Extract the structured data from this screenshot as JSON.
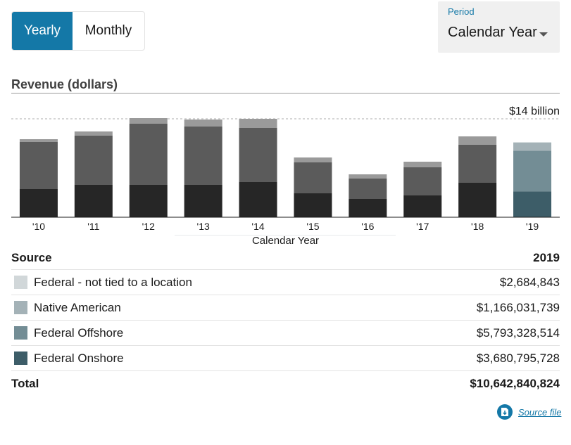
{
  "toggle": {
    "yearly": "Yearly",
    "monthly": "Monthly"
  },
  "period": {
    "label": "Period",
    "value": "Calendar Year"
  },
  "chart_data": {
    "type": "bar",
    "stacked": true,
    "title": "Revenue (dollars)",
    "xlabel": "Calendar Year",
    "max_label": "$14 billion",
    "ylim": [
      0,
      14000000000
    ],
    "categories": [
      "'10",
      "'11",
      "'12",
      "'13",
      "'14",
      "'15",
      "'16",
      "'17",
      "'18",
      "'19"
    ],
    "highlight_category": "'19",
    "series": [
      {
        "name": "Federal Onshore",
        "color": "#3d5d68",
        "values": [
          4000000000,
          4600000000,
          4600000000,
          4600000000,
          5000000000,
          3400000000,
          2600000000,
          3100000000,
          4900000000,
          3680795728
        ]
      },
      {
        "name": "Federal Offshore",
        "color": "#738d95",
        "values": [
          6700000000,
          7000000000,
          8700000000,
          8300000000,
          7700000000,
          4400000000,
          2900000000,
          4000000000,
          5400000000,
          5793328514
        ]
      },
      {
        "name": "Native American",
        "color": "#a4b2b7",
        "values": [
          400000000,
          600000000,
          800000000,
          1000000000,
          1300000000,
          700000000,
          600000000,
          800000000,
          1200000000,
          1166031739
        ]
      },
      {
        "name": "Federal - not tied to a location",
        "color": "#d1d7d9",
        "values": [
          0,
          0,
          0,
          0,
          0,
          0,
          0,
          0,
          0,
          2684843
        ]
      }
    ],
    "grayscale": [
      "#262626",
      "#5b5b5b",
      "#9a9a9a",
      "#cccccc"
    ]
  },
  "legend": {
    "source_header": "Source",
    "year_header": "2019",
    "rows": [
      {
        "name": "Federal - not tied to a location",
        "value": "$2,684,843",
        "color": "#d1d7d9"
      },
      {
        "name": "Native American",
        "value": "$1,166,031,739",
        "color": "#a4b2b7"
      },
      {
        "name": "Federal Offshore",
        "value": "$5,793,328,514",
        "color": "#738d95"
      },
      {
        "name": "Federal Onshore",
        "value": "$3,680,795,728",
        "color": "#3d5d68"
      }
    ],
    "total_label": "Total",
    "total_value": "$10,642,840,824"
  },
  "source_link": "Source file",
  "accent_color": "#1478a7"
}
